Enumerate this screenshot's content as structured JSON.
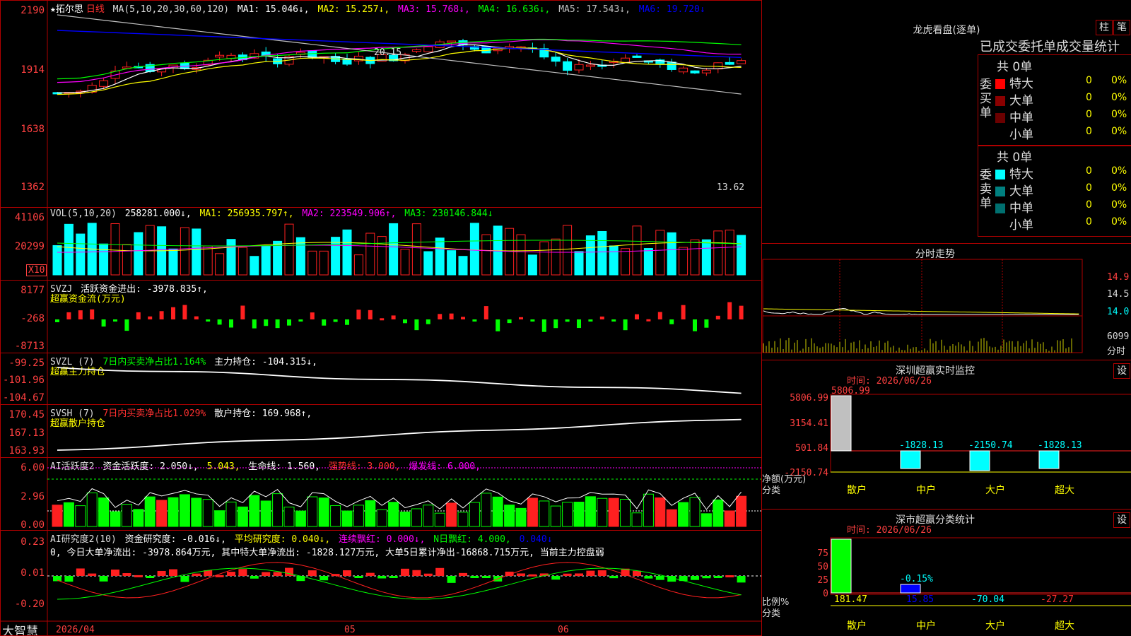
{
  "app": {
    "brand": "大智慧"
  },
  "colors": {
    "up": "#ff2020",
    "down": "#00ffff",
    "ma1": "#ffffff",
    "ma2": "#ffff00",
    "ma3": "#ff00ff",
    "ma4": "#00ff00",
    "ma5": "#c0c0c0",
    "ma6": "#0000ff",
    "frame": "#b00000"
  },
  "kline": {
    "name": "★拓尔思",
    "period": "日线",
    "ma_label": "MA(5,10,20,30,60,120)",
    "ma1": "MA1: 15.046↓,",
    "ma2": "MA2: 15.257↓,",
    "ma3": "MA3: 15.768↓,",
    "ma4": "MA4: 16.636↓,",
    "ma5": "MA5: 17.543↓,",
    "ma6": "MA6: 19.720↓",
    "y_ticks": [
      "2190",
      "1914",
      "1638",
      "1362"
    ],
    "high_label": "20.15",
    "low_label": "13.62"
  },
  "vol": {
    "label": "VOL(5,10,20)",
    "value": "258281.000↓,",
    "ma1": "MA1: 256935.797↑,",
    "ma2": "MA2: 223549.906↑,",
    "ma3": "MA3: 230146.844↓",
    "y_ticks": [
      "41106",
      "20299"
    ],
    "unit": "X10"
  },
  "svzj": {
    "label": "SVZJ",
    "text": "活跃资金进出: -3978.835↑,",
    "sub": "超赢资金流(万元)",
    "y_ticks": [
      "8177",
      "-268",
      "-8713"
    ]
  },
  "svzl": {
    "label": "SVZL (7)",
    "rate": "7日内买卖净占比1.164%",
    "text": "主力持仓: -104.315↓,",
    "sub": "超赢主力持仓",
    "y_ticks": [
      "-99.25",
      "-101.96",
      "-104.67"
    ]
  },
  "svsh": {
    "label": "SVSH (7)",
    "rate": "7日内买卖净占比1.029%",
    "text": "散户持仓: 169.968↑,",
    "sub": "超赢散户持仓",
    "y_ticks": [
      "170.45",
      "167.13",
      "163.93"
    ]
  },
  "ai1": {
    "label": "AI活跃度2",
    "t1": "资金活跃度: 2.050↓,",
    "t2": "5.043,",
    "t3": "生命线: 1.560,",
    "t4": "强势线: 3.000,",
    "t5": "爆发线: 6.000,",
    "y_ticks": [
      "6.00",
      "2.96",
      "0.00"
    ]
  },
  "ai2": {
    "label": "AI研究度2(10)",
    "t1": "资金研究度: -0.016↓,",
    "t2": "平均研究度: 0.040↓,",
    "t3": "连续飘红: 0.000↓,",
    "t4": "N日飘红: 4.000,",
    "t5": "0.040↓",
    "note": "0, 今日大单净流出: -3978.864万元, 其中特大单净流出: -1828.127万元, 大单5日累计净出-16868.715万元, 当前主力控盘弱",
    "y_ticks": [
      "0.23",
      "0.01",
      "-0.20"
    ]
  },
  "dates": [
    "2026/04",
    "05",
    "06"
  ],
  "lhb": {
    "title": "龙虎看盘(逐单)",
    "btn1": "柱",
    "btn2": "笔",
    "subtitle": "已成交委托单成交量统计",
    "buy": {
      "side": "委买单",
      "total": "共 0单",
      "rows": [
        {
          "name": "特大",
          "v": "0",
          "p": "0%",
          "c": "#ff0000"
        },
        {
          "name": "大单",
          "v": "0",
          "p": "0%",
          "c": "#8b0000"
        },
        {
          "name": "中单",
          "v": "0",
          "p": "0%",
          "c": "#6b0000"
        },
        {
          "name": "小单",
          "v": "0",
          "p": "0%",
          "c": "#000000"
        }
      ]
    },
    "sell": {
      "side": "委卖单",
      "total": "共 0单",
      "rows": [
        {
          "name": "特大",
          "v": "0",
          "p": "0%",
          "c": "#00ffff"
        },
        {
          "name": "大单",
          "v": "0",
          "p": "0%",
          "c": "#008080"
        },
        {
          "name": "中单",
          "v": "0",
          "p": "0%",
          "c": "#007070"
        },
        {
          "name": "小单",
          "v": "0",
          "p": "0%",
          "c": "#000000"
        }
      ]
    }
  },
  "fenshi": {
    "title": "分时走势",
    "prices": [
      "14.9",
      "14.5",
      "14.0"
    ],
    "vol": "6099",
    "vol_label": "分时"
  },
  "sz_monitor": {
    "title": "深圳超赢实时监控",
    "btn": "设",
    "time": "时间: 2026/06/26",
    "y_ticks": [
      "5806.99",
      "3154.41",
      "501.84",
      "-2150.74"
    ],
    "top_value": "5806.99",
    "values": [
      "-1828.13",
      "-2150.74",
      "-1828.13"
    ],
    "ylabel": "净额(万元)",
    "xlabel": "分类",
    "cats": [
      "散户",
      "中户",
      "大户",
      "超大"
    ]
  },
  "sz_class": {
    "title": "深市超赢分类统计",
    "btn": "设",
    "time": "时间: 2026/06/26",
    "y_ticks": [
      "75",
      "50",
      "25",
      "0"
    ],
    "mid_value": "0.15%",
    "values": [
      "181.47",
      "15.85",
      "-70.04",
      "-27.27"
    ],
    "ylabel": "比例%",
    "xlabel": "分类",
    "cats": [
      "散户",
      "中户",
      "大户",
      "超大"
    ]
  }
}
